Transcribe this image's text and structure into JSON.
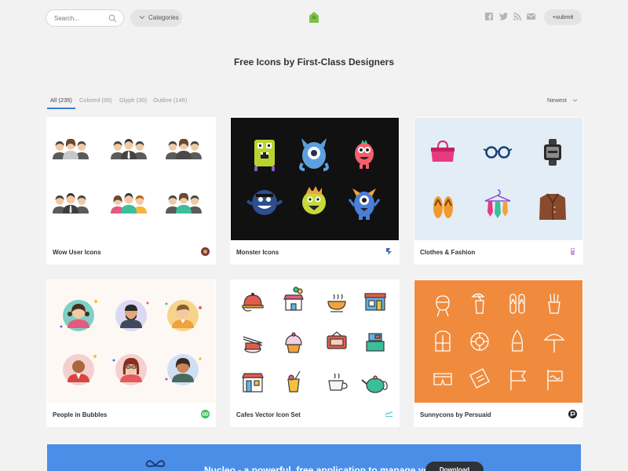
{
  "header": {
    "search_placeholder": "Search...",
    "categories_label": "Categories",
    "submit_label": "+submit",
    "social_icons": [
      "facebook-icon",
      "twitter-icon",
      "rss-icon",
      "mail-icon"
    ],
    "brand_color": "#7cc04b"
  },
  "page_title": "Free Icons by First-Class Designers",
  "filters": {
    "tabs": [
      {
        "label": "All (235)",
        "active": true
      },
      {
        "label": "Colored (95)",
        "active": false
      },
      {
        "label": "Glyph (30)",
        "active": false
      },
      {
        "label": "Outline (146)",
        "active": false
      }
    ],
    "sort_label": "Newest"
  },
  "cards": [
    {
      "title": "Wow User Icons",
      "background": "#ffffff"
    },
    {
      "title": "Monster Icons",
      "background": "#111111"
    },
    {
      "title": "Clothes & Fashion",
      "background": "#e2edf5"
    },
    {
      "title": "People in Bubbles",
      "background": "#fdf8f3"
    },
    {
      "title": "Cafes Vector Icon Set",
      "background": "#ffffff"
    },
    {
      "title": "Sunnycons by Persuaid",
      "background": "#f08b3e"
    }
  ],
  "banner": {
    "text": "Nucleo - a powerful, free application to manage your icons",
    "button_label": "Download",
    "background": "#4a8ee8"
  }
}
